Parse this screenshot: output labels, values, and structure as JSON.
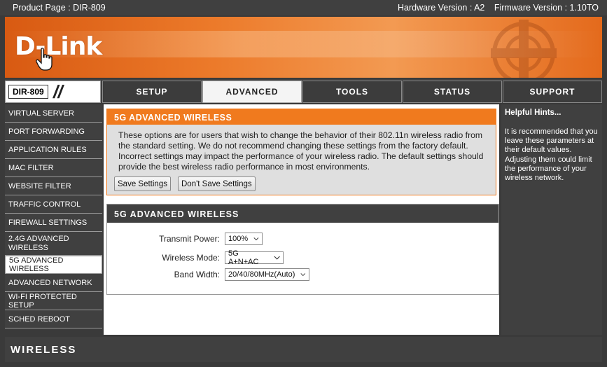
{
  "topbar": {
    "product_page": "Product Page : DIR-809",
    "hardware_version": "Hardware Version : A2",
    "firmware_version": "Firmware Version : 1.10TO"
  },
  "brand": {
    "logo": "D-Link"
  },
  "nav": {
    "model": "DIR-809",
    "tabs": [
      "SETUP",
      "ADVANCED",
      "TOOLS",
      "STATUS",
      "SUPPORT"
    ],
    "active_tab": "ADVANCED"
  },
  "sidebar": {
    "items": [
      "VIRTUAL SERVER",
      "PORT FORWARDING",
      "APPLICATION RULES",
      "MAC FILTER",
      "WEBSITE FILTER",
      "TRAFFIC CONTROL",
      "FIREWALL SETTINGS",
      "2.4G ADVANCED WIRELESS",
      "5G ADVANCED WIRELESS",
      "ADVANCED NETWORK",
      "WI-FI PROTECTED SETUP",
      "SCHED REBOOT"
    ],
    "active": "5G ADVANCED WIRELESS"
  },
  "intro": {
    "title": "5G ADVANCED WIRELESS",
    "text": "These options are for users that wish to change the behavior of their 802.11n wireless radio from the standard setting. We do not recommend changing these settings from the factory default. Incorrect settings may impact the performance of your wireless radio. The default settings should provide the best wireless radio performance in most environments.",
    "save_label": "Save Settings",
    "dont_save_label": "Don't Save Settings"
  },
  "settings": {
    "title": "5G ADVANCED WIRELESS",
    "transmit_power_label": "Transmit Power:",
    "transmit_power_value": "100%",
    "wireless_mode_label": "Wireless Mode:",
    "wireless_mode_value": "5G A+N+AC",
    "band_width_label": "Band Width:",
    "band_width_value": "20/40/80MHz(Auto)"
  },
  "hints": {
    "title": "Helpful Hints...",
    "body": "It is recommended that you leave these parameters at their default values. Adjusting them could limit the performance of your wireless network."
  },
  "footer": {
    "label": "WIRELESS"
  },
  "colors": {
    "accent": "#f07a1e",
    "dark": "#404040"
  }
}
